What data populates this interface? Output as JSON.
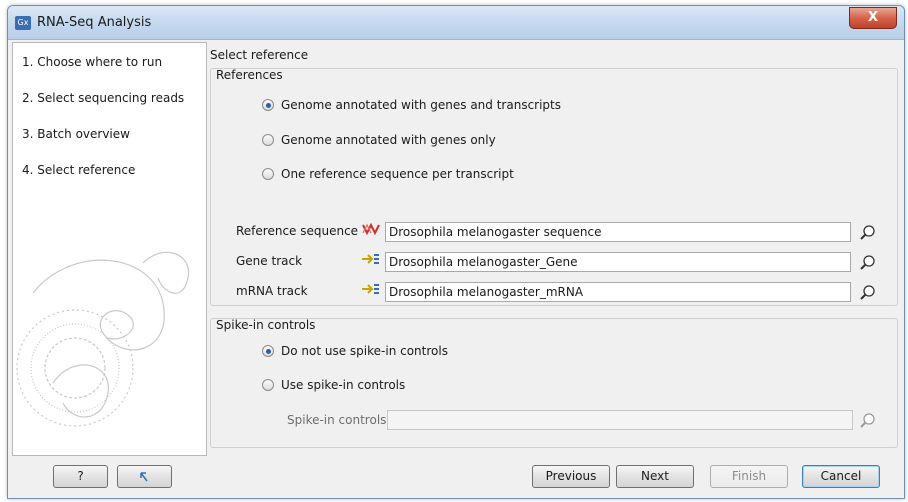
{
  "window": {
    "title": "RNA-Seq Analysis",
    "app_icon": "Gx",
    "close_symbol": "X"
  },
  "steps": [
    "1.  Choose where to run",
    "2.  Select sequencing reads",
    "3.  Batch overview",
    "4.  Select reference"
  ],
  "page_heading": "Select reference",
  "references": {
    "title": "References",
    "options": [
      {
        "label": "Genome annotated with genes and transcripts",
        "selected": true
      },
      {
        "label": "Genome annotated with genes only",
        "selected": false
      },
      {
        "label": "One reference sequence per transcript",
        "selected": false
      }
    ],
    "fields": [
      {
        "label": "Reference sequence",
        "value": "Drosophila melanogaster sequence",
        "icon": "sequence-icon"
      },
      {
        "label": "Gene track",
        "value": "Drosophila melanogaster_Gene",
        "icon": "track-icon"
      },
      {
        "label": "mRNA track",
        "value": "Drosophila melanogaster_mRNA",
        "icon": "track-icon"
      }
    ]
  },
  "spike_in": {
    "title": "Spike-in controls",
    "options": [
      {
        "label": "Do not use spike-in controls",
        "selected": true
      },
      {
        "label": "Use spike-in controls",
        "selected": false
      }
    ],
    "field_label": "Spike-in controls",
    "field_value": ""
  },
  "footer": {
    "help": "?",
    "previous": "Previous",
    "next": "Next",
    "finish": "Finish",
    "cancel": "Cancel"
  }
}
